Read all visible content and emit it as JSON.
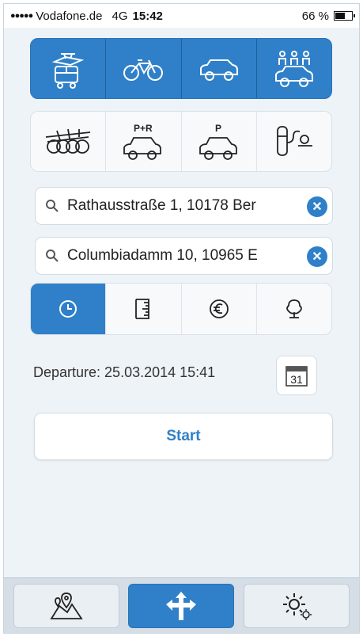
{
  "status_bar": {
    "signal": "●●●●●",
    "carrier": "Vodafone.de",
    "network": "4G",
    "time": "15:42",
    "battery": "66 %",
    "battery_level": 0.66
  },
  "modes": [
    {
      "icon": "tram-icon",
      "active": true
    },
    {
      "icon": "bicycle-icon",
      "active": true
    },
    {
      "icon": "car-icon",
      "active": true
    },
    {
      "icon": "carpool-icon",
      "active": true
    }
  ],
  "options": [
    {
      "icon": "bike-sharing-icon"
    },
    {
      "icon": "park-and-ride-icon",
      "label": "P+R"
    },
    {
      "icon": "parking-icon",
      "label": "P"
    },
    {
      "icon": "ev-charging-icon"
    }
  ],
  "search": {
    "from_value": "Rathausstraße 1, 10178 Ber",
    "to_value": "Columbiadamm 10, 10965 E",
    "search_icon": "search-icon",
    "clear_icon": "clear-icon"
  },
  "preferences": [
    {
      "icon": "clock-icon",
      "active": true
    },
    {
      "icon": "ruler-icon",
      "active": false
    },
    {
      "icon": "euro-icon",
      "active": false
    },
    {
      "icon": "tree-icon",
      "active": false
    }
  ],
  "departure": {
    "text": "Departure: 25.03.2014 15:41",
    "calendar_day": "31"
  },
  "start_label": "Start",
  "tabs": [
    {
      "icon": "map-pin-icon",
      "active": false
    },
    {
      "icon": "route-arrows-icon",
      "active": true
    },
    {
      "icon": "settings-icon",
      "active": false
    }
  ],
  "colors": {
    "accent": "#2f80c9",
    "background": "#eef3f8"
  }
}
